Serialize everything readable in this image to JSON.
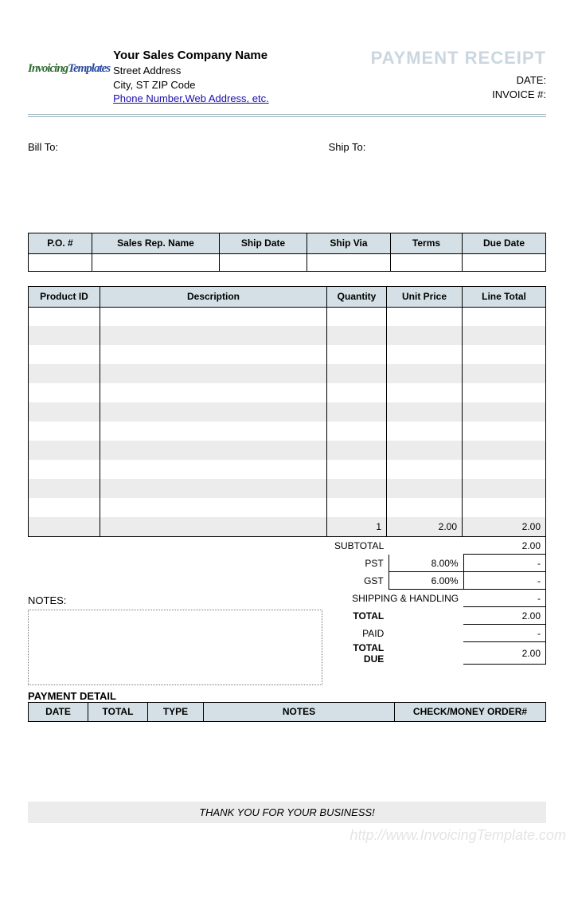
{
  "header": {
    "company_name": "Your Sales Company Name",
    "street": "Street Address",
    "city_st_zip": "City, ST  ZIP Code",
    "contact_link": "Phone Number,Web Address, etc.",
    "title": "PAYMENT RECEIPT",
    "date_label": "DATE:",
    "invoice_label": "INVOICE #:"
  },
  "address": {
    "bill_to_label": "Bill To:",
    "ship_to_label": "Ship To:"
  },
  "po_headers": {
    "po": "P.O. #",
    "rep": "Sales Rep. Name",
    "ship_date": "Ship Date",
    "ship_via": "Ship Via",
    "terms": "Terms",
    "due_date": "Due Date"
  },
  "items_headers": {
    "pid": "Product ID",
    "desc": "Description",
    "qty": "Quantity",
    "up": "Unit Price",
    "lt": "Line Total"
  },
  "items_last": {
    "qty": "1",
    "up": "2.00",
    "lt": "2.00"
  },
  "summary": {
    "subtotal_label": "SUBTOTAL",
    "subtotal_val": "2.00",
    "pst_label": "PST",
    "pst_rate": "8.00%",
    "pst_val": "-",
    "gst_label": "GST",
    "gst_rate": "6.00%",
    "gst_val": "-",
    "ship_label": "SHIPPING & HANDLING",
    "ship_val": "-",
    "total_label": "TOTAL",
    "total_val": "2.00",
    "paid_label": "PAID",
    "paid_val": "-",
    "due_label": "TOTAL DUE",
    "due_val": "2.00"
  },
  "notes_label": "NOTES:",
  "payment_detail_label": "PAYMENT DETAIL",
  "pay_headers": {
    "date": "DATE",
    "total": "TOTAL",
    "type": "TYPE",
    "notes": "NOTES",
    "check": "CHECK/MONEY ORDER#"
  },
  "thanks": "THANK YOU FOR YOUR BUSINESS!",
  "watermark": "http://www.InvoicingTemplate.com",
  "logo": {
    "p1": "Invoicing",
    "p2": "Templates"
  }
}
